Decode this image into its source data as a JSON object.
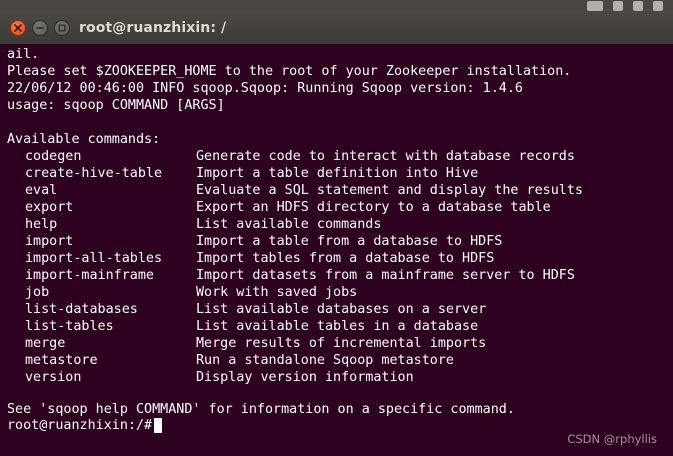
{
  "window": {
    "title": "root@ruanzhixin: /"
  },
  "terminal": {
    "lines": [
      "ail.",
      "Please set $ZOOKEEPER_HOME to the root of your Zookeeper installation.",
      "22/06/12 00:46:00 INFO sqoop.Sqoop: Running Sqoop version: 1.4.6",
      "usage: sqoop COMMAND [ARGS]",
      "",
      "Available commands:"
    ],
    "commands": [
      {
        "name": "codegen",
        "desc": "Generate code to interact with database records"
      },
      {
        "name": "create-hive-table",
        "desc": "Import a table definition into Hive"
      },
      {
        "name": "eval",
        "desc": "Evaluate a SQL statement and display the results"
      },
      {
        "name": "export",
        "desc": "Export an HDFS directory to a database table"
      },
      {
        "name": "help",
        "desc": "List available commands"
      },
      {
        "name": "import",
        "desc": "Import a table from a database to HDFS"
      },
      {
        "name": "import-all-tables",
        "desc": "Import tables from a database to HDFS"
      },
      {
        "name": "import-mainframe",
        "desc": "Import datasets from a mainframe server to HDFS"
      },
      {
        "name": "job",
        "desc": "Work with saved jobs"
      },
      {
        "name": "list-databases",
        "desc": "List available databases on a server"
      },
      {
        "name": "list-tables",
        "desc": "List available tables in a database"
      },
      {
        "name": "merge",
        "desc": "Merge results of incremental imports"
      },
      {
        "name": "metastore",
        "desc": "Run a standalone Sqoop metastore"
      },
      {
        "name": "version",
        "desc": "Display version information"
      }
    ],
    "footer_line": "See 'sqoop help COMMAND' for information on a specific command.",
    "prompt": "root@ruanzhixin:/#"
  },
  "watermark": "CSDN @rphyllis",
  "icons": {
    "close": "close-icon",
    "minimize": "minimize-icon",
    "maximize": "maximize-icon",
    "keyboard": "keyboard-icon",
    "network": "network-icon",
    "bluetooth": "bluetooth-icon",
    "volume": "volume-icon"
  },
  "colors": {
    "terminal_bg": "#2c001e",
    "text": "#ffffff",
    "titlebar": "#3c3b37",
    "close_button": "#df4a16"
  }
}
